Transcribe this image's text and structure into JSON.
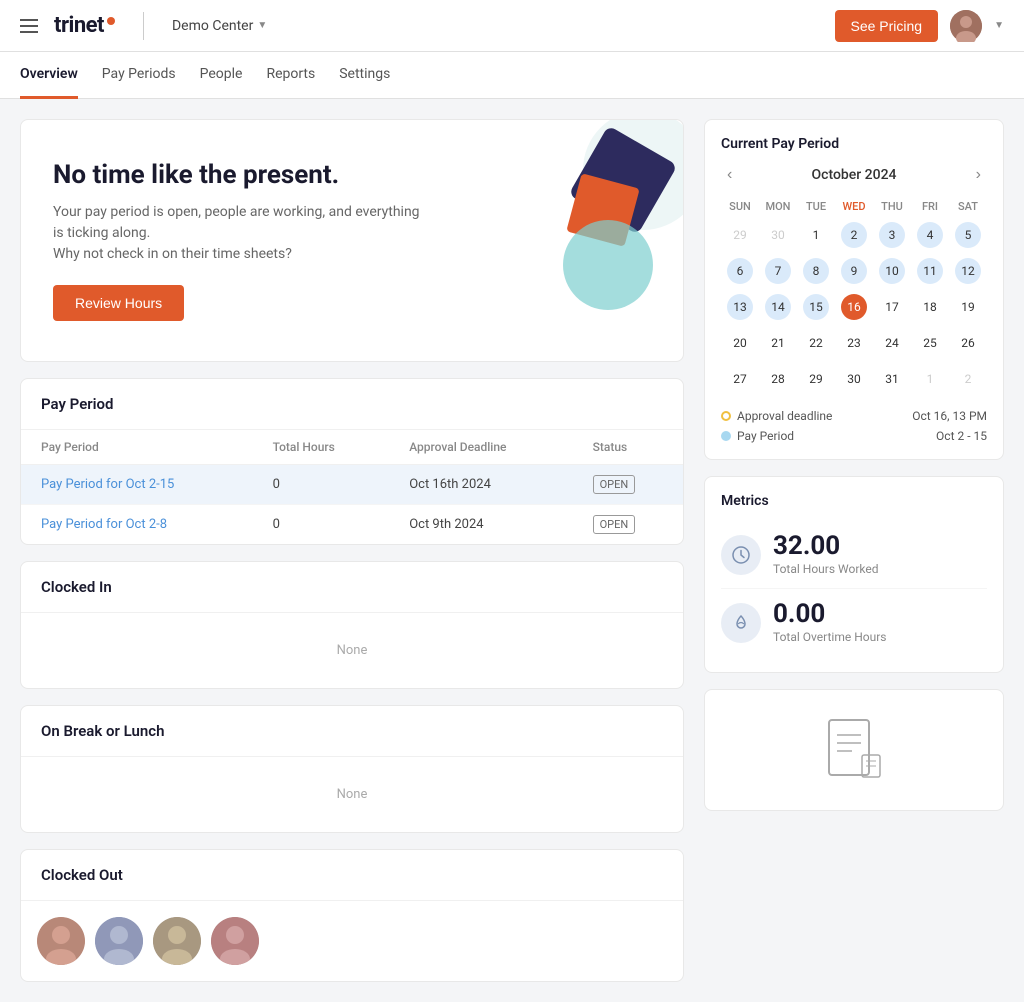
{
  "topNav": {
    "logoText": "trinet",
    "demoCenter": "Demo Center",
    "seePricingLabel": "See Pricing"
  },
  "subNav": {
    "items": [
      {
        "label": "Overview",
        "active": true
      },
      {
        "label": "Pay Periods",
        "active": false
      },
      {
        "label": "People",
        "active": false
      },
      {
        "label": "Reports",
        "active": false
      },
      {
        "label": "Settings",
        "active": false
      }
    ]
  },
  "hero": {
    "title": "No time like the present.",
    "subtitle": "Your pay period is open, people are working, and everything is ticking along.\nWhy not check in on their time sheets?",
    "reviewButtonLabel": "Review Hours"
  },
  "payPeriod": {
    "sectionTitle": "Pay Period",
    "columns": [
      "Pay Period",
      "Total Hours",
      "Approval Deadline",
      "Status"
    ],
    "rows": [
      {
        "payPeriod": "Pay Period for Oct 2-15",
        "totalHours": "0",
        "approvalDeadline": "Oct 16th 2024",
        "status": "OPEN",
        "highlighted": true
      },
      {
        "payPeriod": "Pay Period for Oct 2-8",
        "totalHours": "0",
        "approvalDeadline": "Oct 9th 2024",
        "status": "OPEN",
        "highlighted": false
      }
    ]
  },
  "clockedIn": {
    "sectionTitle": "Clocked In",
    "emptyLabel": "None"
  },
  "onBreak": {
    "sectionTitle": "On Break or Lunch",
    "emptyLabel": "None"
  },
  "clockedOut": {
    "sectionTitle": "Clocked Out"
  },
  "calendar": {
    "sectionTitle": "Current Pay Period",
    "monthLabel": "October 2024",
    "dayHeaders": [
      "SUN",
      "MON",
      "TUE",
      "WED",
      "THU",
      "FRI",
      "SAT"
    ],
    "weeks": [
      [
        {
          "day": "29",
          "otherMonth": true
        },
        {
          "day": "30",
          "otherMonth": true
        },
        {
          "day": "1"
        },
        {
          "day": "2",
          "payPeriod": true
        },
        {
          "day": "3",
          "payPeriod": true
        },
        {
          "day": "4",
          "payPeriod": true
        },
        {
          "day": "5",
          "payPeriod": true
        }
      ],
      [
        {
          "day": "6",
          "payPeriod": true
        },
        {
          "day": "7",
          "payPeriod": true
        },
        {
          "day": "8",
          "payPeriod": true
        },
        {
          "day": "9",
          "payPeriod": true
        },
        {
          "day": "10",
          "payPeriod": true
        },
        {
          "day": "11",
          "payPeriod": true
        },
        {
          "day": "12",
          "payPeriod": true
        }
      ],
      [
        {
          "day": "13",
          "payPeriod": true
        },
        {
          "day": "14",
          "payPeriod": true
        },
        {
          "day": "15",
          "payPeriod": true
        },
        {
          "day": "16",
          "today": true
        },
        {
          "day": "17"
        },
        {
          "day": "18"
        },
        {
          "day": "19"
        }
      ],
      [
        {
          "day": "20"
        },
        {
          "day": "21"
        },
        {
          "day": "22"
        },
        {
          "day": "23"
        },
        {
          "day": "24"
        },
        {
          "day": "25"
        },
        {
          "day": "26"
        }
      ],
      [
        {
          "day": "27"
        },
        {
          "day": "28"
        },
        {
          "day": "29"
        },
        {
          "day": "30"
        },
        {
          "day": "31"
        },
        {
          "day": "1",
          "otherMonth": true
        },
        {
          "day": "2",
          "otherMonth": true
        }
      ]
    ],
    "legend": {
      "approvalLabel": "Approval deadline",
      "approvalDate": "Oct 16, 13 PM",
      "payPeriodLabel": "Pay Period",
      "payPeriodDate": "Oct 2 - 15"
    }
  },
  "metrics": {
    "sectionTitle": "Metrics",
    "totalHours": {
      "value": "32.00",
      "label": "Total Hours Worked"
    },
    "overtimeHours": {
      "value": "0.00",
      "label": "Total Overtime Hours"
    }
  }
}
